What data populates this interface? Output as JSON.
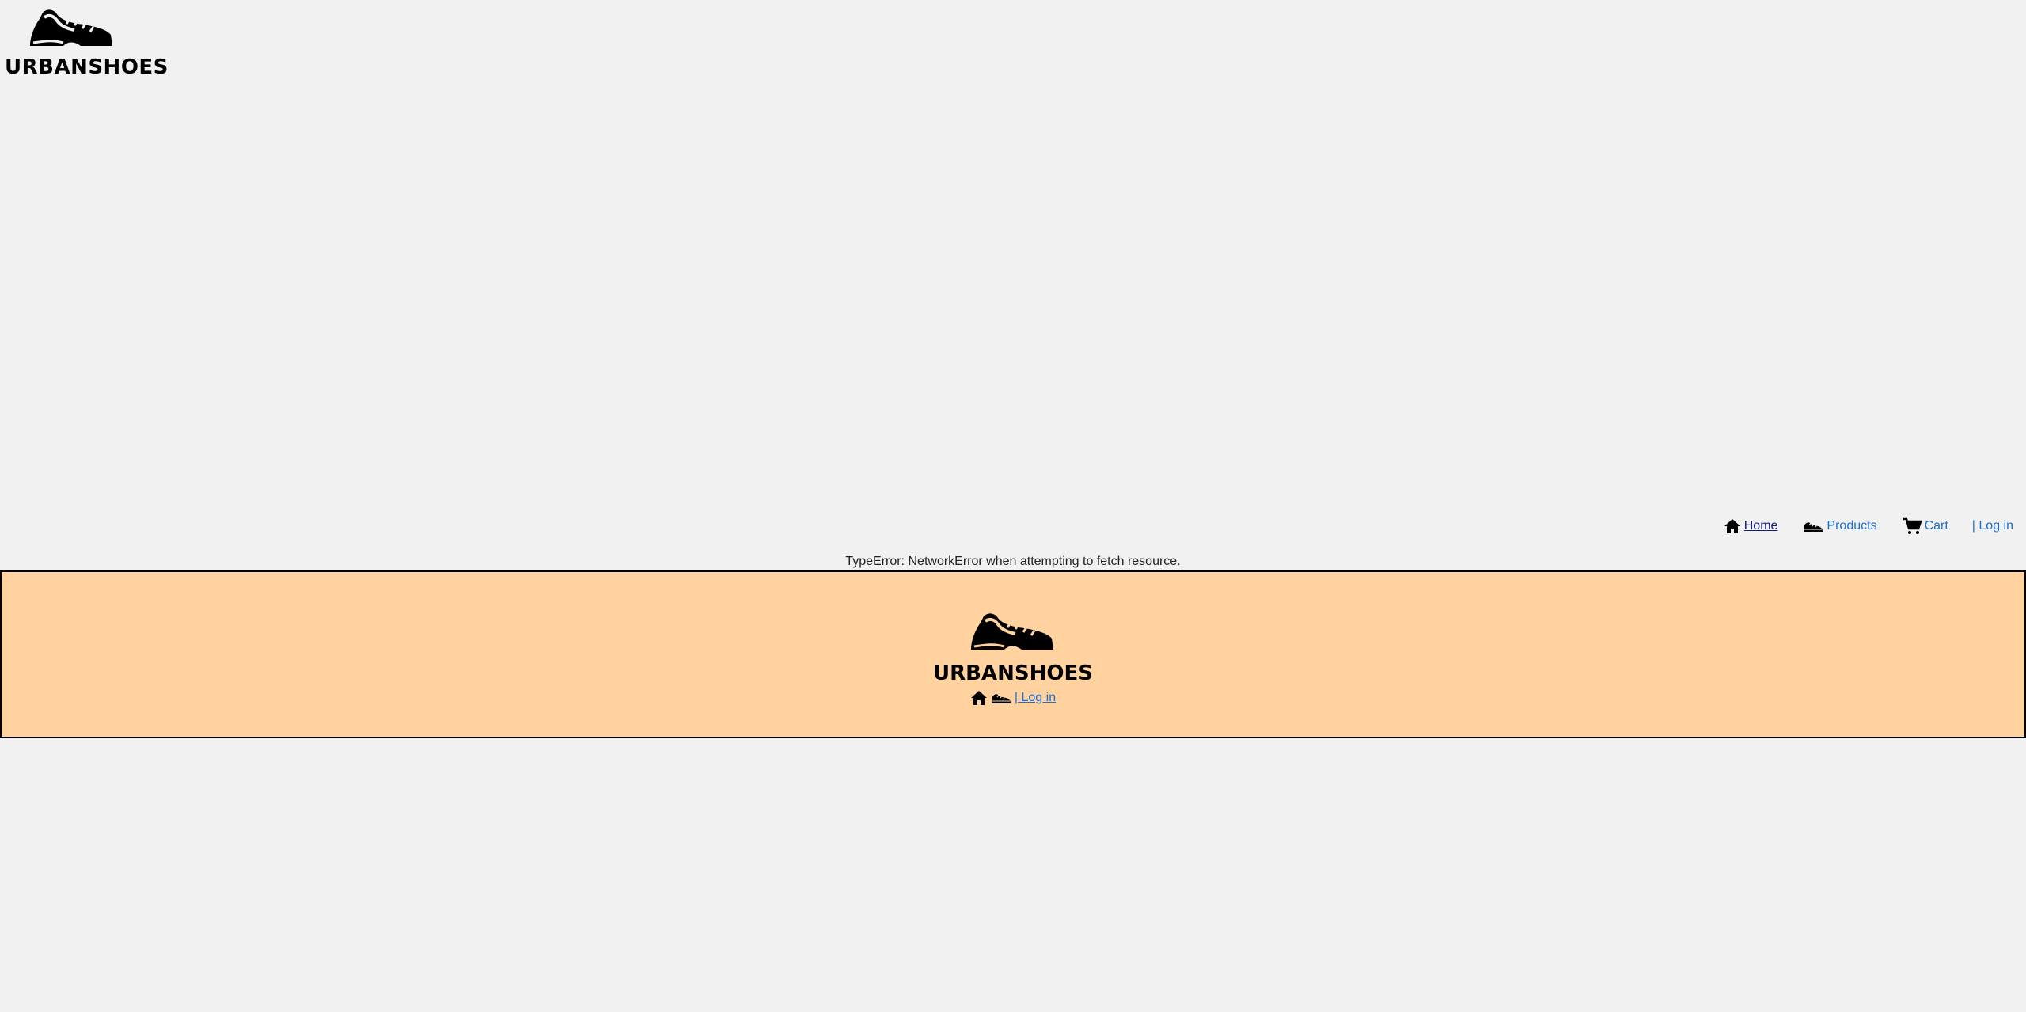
{
  "header": {
    "logo_icon": "shoe-icon",
    "brand": "URBANSHOES"
  },
  "nav": {
    "home": "Home",
    "products": "Products",
    "cart": "Cart",
    "login": "| Log in",
    "icons": [
      "home-icon",
      "sneaker-icon",
      "cart-icon"
    ]
  },
  "error": {
    "message": "TypeError: NetworkError when attempting to fetch resource."
  },
  "footer": {
    "brand": "URBANSHOES",
    "login": "| Log in",
    "background": "#ffd29f"
  },
  "colors": {
    "link": "#1a6fd1",
    "visited_link": "#1a1a80",
    "page_bg": "#f1f1f1"
  }
}
